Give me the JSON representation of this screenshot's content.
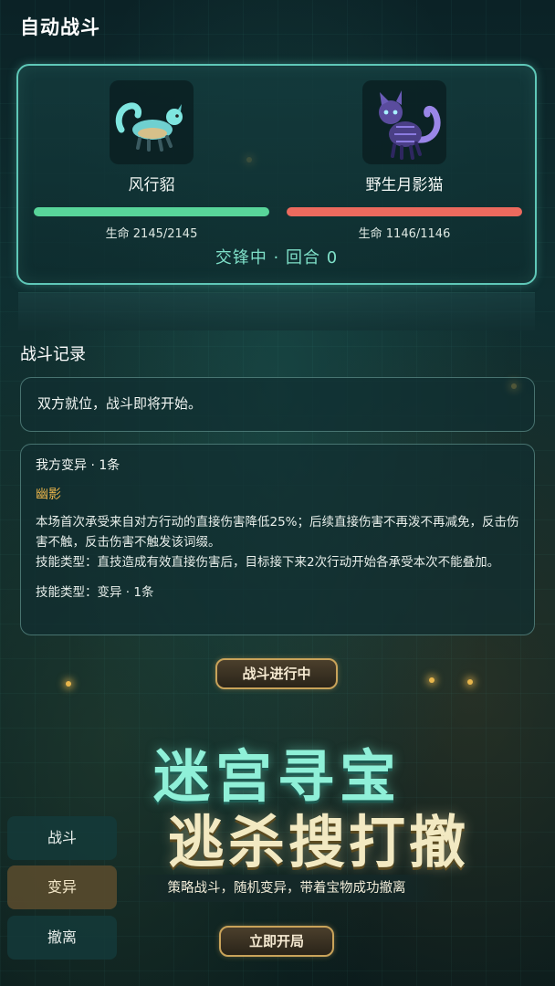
{
  "header": {
    "title": "自动战斗"
  },
  "battle": {
    "player": {
      "name": "风行貂",
      "hp_text": "生命 2145/2145",
      "hp_fraction": 1.0
    },
    "enemy": {
      "name": "野生月影猫",
      "hp_text": "生命 1146/1146",
      "hp_fraction": 1.0
    },
    "status": "交锋中 · 回合 0"
  },
  "log": {
    "title": "战斗记录",
    "entries": [
      "双方就位，战斗即将开始。"
    ]
  },
  "mutation": {
    "header": "我方变异 · 1条",
    "name": "幽影",
    "description": "本场首次承受来自对方行动的直接伤害降低25%；后续直接伤害不再泼不再减免，反击伤害不触，反击伤害不触发该词缀。",
    "description2": "技能类型：直技造成有效直接伤害后，目标接下来2次行动开始各承受本次不能叠加。",
    "footer": "技能类型：变异 · 1条"
  },
  "buttons": {
    "fighting": "战斗进行中",
    "start": "立即开局"
  },
  "promo": {
    "line1": "迷宫寻宝",
    "line2": "逃杀搜打撤",
    "subtitle": "策略战斗，随机变异，带着宝物成功撤离"
  },
  "side_tabs": [
    "战斗",
    "变异",
    "撤离"
  ],
  "colors": {
    "accent": "#5fc8b8",
    "hp_player": "#58d59a",
    "hp_enemy": "#ec6a5e",
    "gold": "#c9a35a"
  }
}
